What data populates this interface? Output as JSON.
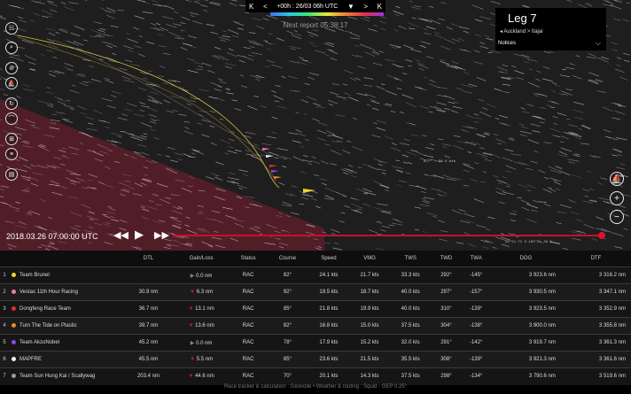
{
  "topbar": {
    "first": "K",
    "prev": "<",
    "time_label": "+00h : 26/03 06h UTC",
    "dropdown": "▼",
    "next": ">",
    "last": "K"
  },
  "map": {
    "report_text": "Next report 05:38:17",
    "cursor_label": "077° - 24.4 kts",
    "coords": "38°51.72 S  105°51.36 W"
  },
  "leg_panel": {
    "leg": "Leg 7",
    "route": "Auckland > Itajai",
    "notices": "Notices"
  },
  "left_tools": [
    {
      "name": "fleet-icon",
      "glyph": "☷"
    },
    {
      "name": "zoom-search-icon",
      "glyph": "⌕"
    },
    {
      "name": "measure-icon",
      "glyph": "⊘"
    },
    {
      "name": "boat-icon",
      "glyph": "⛵"
    },
    {
      "name": "wind-icon",
      "glyph": "↻"
    },
    {
      "name": "layers-icon",
      "glyph": "⌒"
    },
    {
      "name": "grid-icon",
      "glyph": "⊞"
    },
    {
      "name": "list-icon",
      "glyph": "≡"
    },
    {
      "name": "chart-icon",
      "glyph": "▤"
    }
  ],
  "right_tools": [
    {
      "name": "sail-icon",
      "glyph": "⛵"
    },
    {
      "name": "zoom-in-icon",
      "glyph": "+"
    },
    {
      "name": "zoom-out-icon",
      "glyph": "−"
    }
  ],
  "playback": {
    "date": "2018.03.26 07:00:00 UTC",
    "rewind": "◀◀",
    "play": "▶",
    "forward": "▶▶"
  },
  "columns": [
    "",
    "",
    "",
    "DTL",
    "Gain/Loss",
    "Status",
    "Course",
    "Speed",
    "VMG",
    "TWS",
    "TWD",
    "TWA",
    "DOG",
    "DTF"
  ],
  "rows": [
    {
      "rank": "1",
      "color": "#f2d22b",
      "team": "Team Brunel",
      "dtl": "",
      "gain_arrow": "▶",
      "gain_dir": "flat",
      "gain": "0.0 nm",
      "status": "RAC",
      "course": "82°",
      "speed": "24.1 kts",
      "vmg": "21.7 kts",
      "tws": "33.3 kts",
      "twd": "292°",
      "twa": "-145°",
      "dog": "3 923.6 nm",
      "dtf": "3 316.2 nm"
    },
    {
      "rank": "2",
      "color": "#f07ab0",
      "team": "Vestas 11th Hour Racing",
      "dtl": "30.9 nm",
      "gain_arrow": "▼",
      "gain_dir": "down",
      "gain": "6.3 nm",
      "status": "RAC",
      "course": "92°",
      "speed": "19.5 kts",
      "vmg": "18.7 kts",
      "tws": "40.0 kts",
      "twd": "297°",
      "twa": "-157°",
      "dog": "3 930.5 nm",
      "dtf": "3 347.1 nm"
    },
    {
      "rank": "3",
      "color": "#e0302a",
      "team": "Dongfeng Race Team",
      "dtl": "36.7 nm",
      "gain_arrow": "▼",
      "gain_dir": "down",
      "gain": "13.1 nm",
      "status": "RAC",
      "course": "85°",
      "speed": "21.8 kts",
      "vmg": "19.9 kts",
      "tws": "40.0 kts",
      "twd": "310°",
      "twa": "-139°",
      "dog": "3 923.5 nm",
      "dtf": "3 352.9 nm"
    },
    {
      "rank": "4",
      "color": "#f08a2a",
      "team": "Turn The Tide on Plastic",
      "dtl": "39.7 nm",
      "gain_arrow": "▼",
      "gain_dir": "down",
      "gain": "13.6 nm",
      "status": "RAC",
      "course": "82°",
      "speed": "16.8 kts",
      "vmg": "15.0 kts",
      "tws": "37.5 kts",
      "twd": "304°",
      "twa": "-138°",
      "dog": "3 900.0 nm",
      "dtf": "3 355.8 nm"
    },
    {
      "rank": "5",
      "color": "#8a4ae0",
      "team": "Team AkzoNobel",
      "dtl": "45.2 nm",
      "gain_arrow": "▶",
      "gain_dir": "flat",
      "gain": "0.0 nm",
      "status": "RAC",
      "course": "78°",
      "speed": "17.9 kts",
      "vmg": "15.2 kts",
      "tws": "32.0 kts",
      "twd": "291°",
      "twa": "-142°",
      "dog": "3 919.7 nm",
      "dtf": "3 361.3 nm"
    },
    {
      "rank": "6",
      "color": "#f4f4f4",
      "team": "MAPFRE",
      "dtl": "45.5 nm",
      "gain_arrow": "▼",
      "gain_dir": "down",
      "gain": "5.5 nm",
      "status": "RAC",
      "course": "85°",
      "speed": "23.6 kts",
      "vmg": "21.5 kts",
      "tws": "35.5 kts",
      "twd": "308°",
      "twa": "-139°",
      "dog": "3 921.3 nm",
      "dtf": "3 361.6 nm"
    },
    {
      "rank": "7",
      "color": "#999999",
      "team": "Team Sun Hung Kai / Scallywag",
      "dtl": "203.4 nm",
      "gain_arrow": "▼",
      "gain_dir": "down",
      "gain": "44.6 nm",
      "status": "RAC",
      "course": "70°",
      "speed": "20.1 kts",
      "vmg": "14.3 kts",
      "tws": "37.5 kts",
      "twd": "298°",
      "twa": "-134°",
      "dog": "3 790.6 nm",
      "dtf": "3 519.6 nm"
    }
  ],
  "footer": "Race tracker & calculation : Géovoile • Weather & routing : Squid - GEP 0.25°",
  "colors": {
    "accent": "#c8102e",
    "ice_zone": "#5a1f2a"
  }
}
